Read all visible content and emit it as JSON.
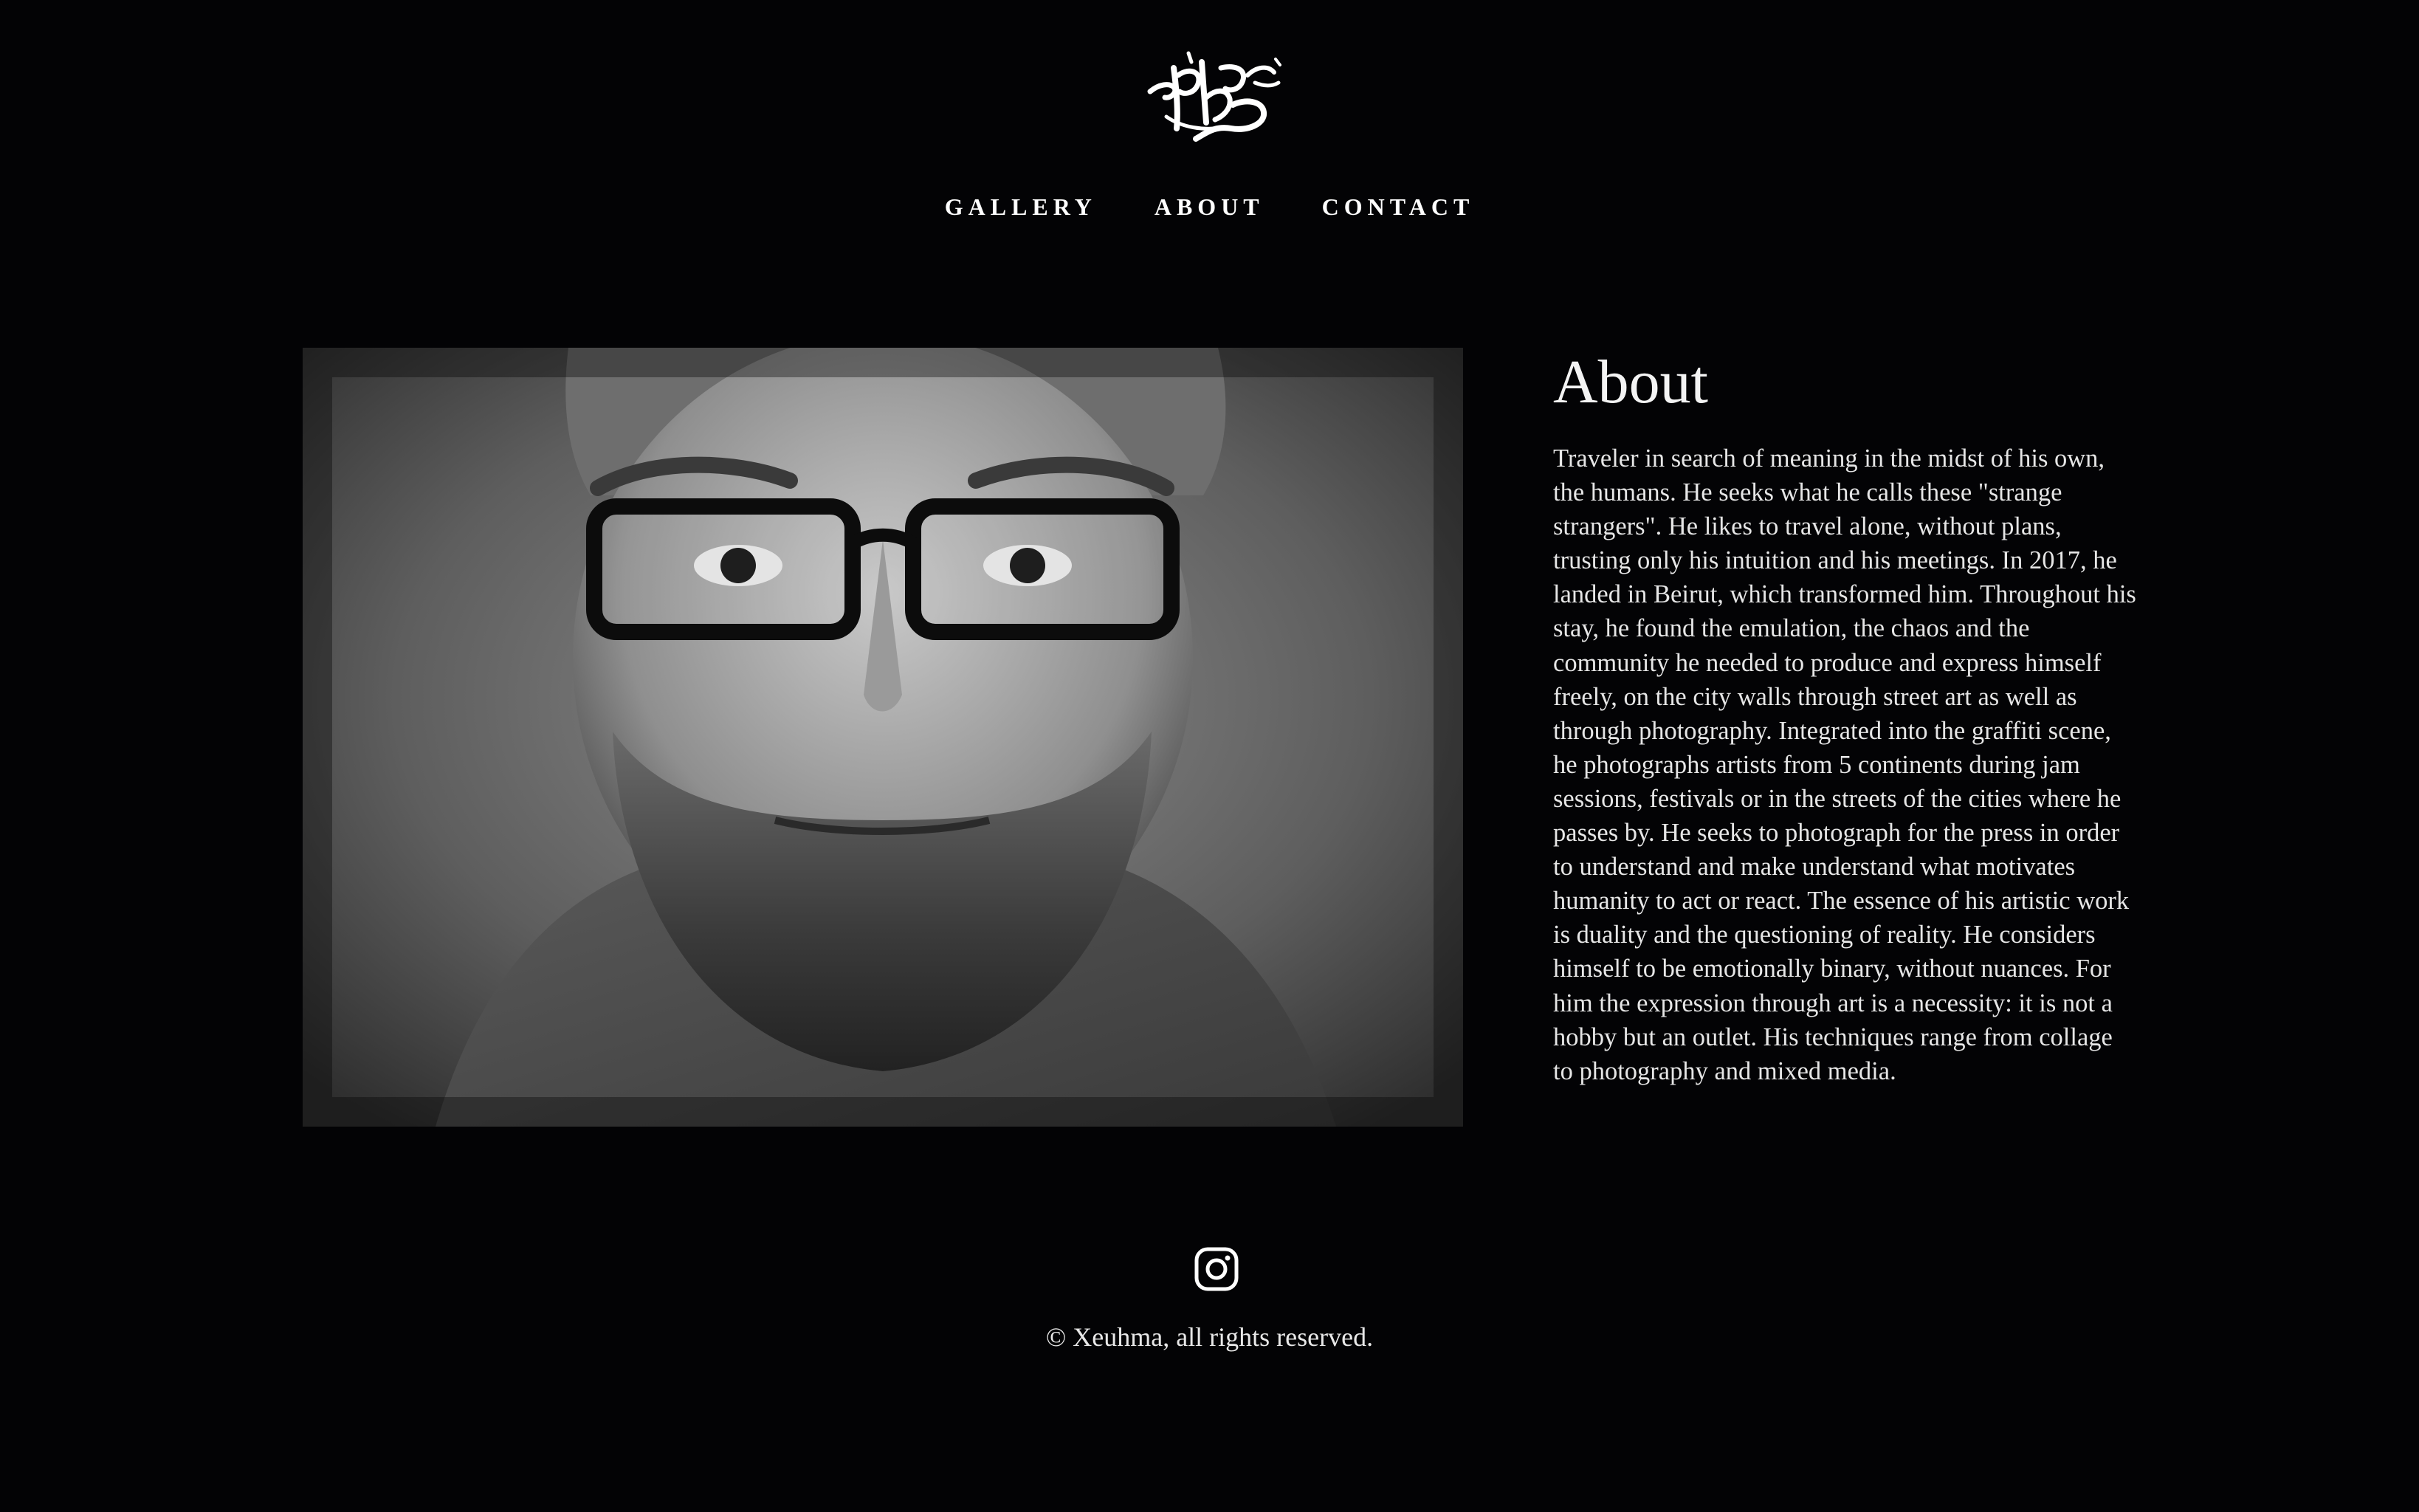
{
  "brand": {
    "logo_icon": "graffiti-tag-logo"
  },
  "nav": {
    "items": [
      {
        "label": "GALLERY"
      },
      {
        "label": "ABOUT"
      },
      {
        "label": "CONTACT"
      }
    ]
  },
  "portrait": {
    "description_icon": "portrait-photo"
  },
  "about": {
    "title": "About",
    "body": "Traveler in search of meaning in the midst of his own, the humans. He seeks what he calls these \"strange strangers\". He likes to travel alone, without plans, trusting only his intuition and his meetings. In 2017, he landed in Beirut, which transformed him. Throughout his stay, he found the emulation, the chaos and the community he needed to produce and express himself freely, on the city walls through street art as well as through photography. Integrated into the graffiti scene, he photographs artists from 5 continents during jam sessions, festivals or in the streets of the cities where he passes by. He seeks to photograph for the press in order to understand and make understand what motivates humanity to act or react. The essence of his artistic work is duality and the questioning of reality. He considers himself to be emotionally binary, without nuances. For him the expression through art is a necessity: it is not a hobby but an outlet. His techniques range from collage to photography and mixed media."
  },
  "footer": {
    "social_icon": "instagram-icon",
    "copyright": "© Xeuhma, all rights reserved."
  },
  "colors": {
    "background": "#030305",
    "text": "#ffffff"
  }
}
